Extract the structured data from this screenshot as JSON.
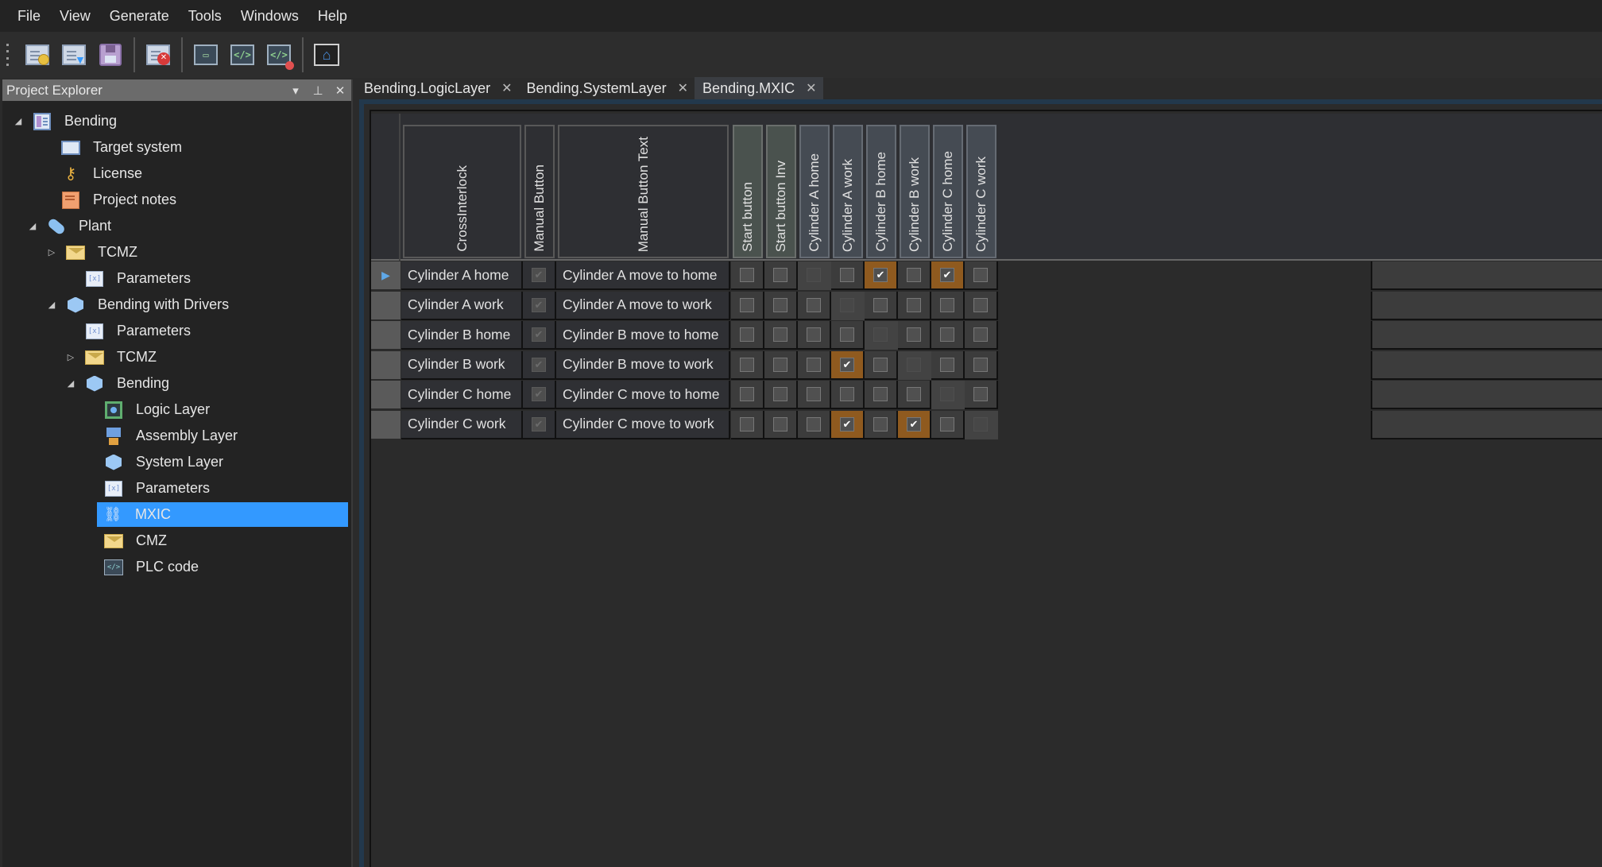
{
  "menu": [
    "File",
    "View",
    "Generate",
    "Tools",
    "Windows",
    "Help"
  ],
  "toolbar": {
    "buttons": [
      {
        "name": "new-project-icon"
      },
      {
        "name": "open-project-icon"
      },
      {
        "name": "save-icon"
      },
      {
        "name": "close-project-icon"
      },
      {
        "name": "generate-layout-icon"
      },
      {
        "name": "generate-code-icon"
      },
      {
        "name": "remove-code-icon"
      },
      {
        "name": "home-icon"
      }
    ]
  },
  "explorer": {
    "title": "Project Explorer",
    "items": [
      {
        "label": "Bending",
        "icon": "project-icon",
        "expander": "open"
      },
      {
        "label": "Target system",
        "icon": "target-system-icon"
      },
      {
        "label": "License",
        "icon": "key-icon"
      },
      {
        "label": "Project notes",
        "icon": "notes-icon"
      },
      {
        "label": "Plant",
        "icon": "plant-icon",
        "expander": "open"
      },
      {
        "label": "TCMZ",
        "icon": "folder-icon",
        "expander": "closed"
      },
      {
        "label": "Parameters",
        "icon": "parameters-icon"
      },
      {
        "label": "Bending with Drivers",
        "icon": "cube-icon",
        "expander": "open"
      },
      {
        "label": "Parameters",
        "icon": "parameters-icon"
      },
      {
        "label": "TCMZ",
        "icon": "folder-icon",
        "expander": "closed"
      },
      {
        "label": "Bending",
        "icon": "cube-icon",
        "expander": "open"
      },
      {
        "label": "Logic Layer",
        "icon": "logic-layer-icon"
      },
      {
        "label": "Assembly Layer",
        "icon": "assembly-layer-icon"
      },
      {
        "label": "System Layer",
        "icon": "cube-icon"
      },
      {
        "label": "Parameters",
        "icon": "parameters-icon"
      },
      {
        "label": "MXIC",
        "icon": "mxic-icon",
        "selected": true
      },
      {
        "label": "CMZ",
        "icon": "folder-icon"
      },
      {
        "label": "PLC code",
        "icon": "code-icon"
      }
    ]
  },
  "tabs": [
    {
      "label": "Bending.LogicLayer",
      "active": false
    },
    {
      "label": "Bending.SystemLayer",
      "active": false
    },
    {
      "label": "Bending.MXIC",
      "active": true
    }
  ],
  "grid": {
    "text_columns": [
      "CrossInterlock",
      "Manual Button",
      "Manual Button Text"
    ],
    "check_columns": [
      {
        "label": "Start button",
        "group": "start"
      },
      {
        "label": "Start button Inv",
        "group": "start"
      },
      {
        "label": "Cylinder A home",
        "group": "cyl"
      },
      {
        "label": "Cylinder A work",
        "group": "cyl"
      },
      {
        "label": "Cylinder B home",
        "group": "cyl"
      },
      {
        "label": "Cylinder B work",
        "group": "cyl"
      },
      {
        "label": "Cylinder C home",
        "group": "cyl"
      },
      {
        "label": "Cylinder C work",
        "group": "cyl"
      }
    ],
    "rows": [
      {
        "name": "Cylinder A home",
        "manual": true,
        "text": "Cylinder A move to home",
        "checks": [
          false,
          false,
          null,
          false,
          true,
          false,
          true,
          false
        ],
        "current": true
      },
      {
        "name": "Cylinder A work",
        "manual": true,
        "text": "Cylinder A move to work",
        "checks": [
          false,
          false,
          false,
          null,
          false,
          false,
          false,
          false
        ]
      },
      {
        "name": "Cylinder B home",
        "manual": true,
        "text": "Cylinder B move to home",
        "checks": [
          false,
          false,
          false,
          false,
          null,
          false,
          false,
          false
        ]
      },
      {
        "name": "Cylinder B work",
        "manual": true,
        "text": "Cylinder B move to work",
        "checks": [
          false,
          false,
          false,
          true,
          false,
          null,
          false,
          false
        ]
      },
      {
        "name": "Cylinder C home",
        "manual": true,
        "text": "Cylinder C move to home",
        "checks": [
          false,
          false,
          false,
          false,
          false,
          false,
          null,
          false
        ]
      },
      {
        "name": "Cylinder C work",
        "manual": true,
        "text": "Cylinder C move to work",
        "checks": [
          false,
          false,
          false,
          true,
          false,
          true,
          false,
          null
        ]
      }
    ],
    "current_row_marker": "▶",
    "check_mark": "✔"
  },
  "colors": {
    "selection": "#3399ff",
    "checked_cell": "#8f5a1f",
    "start_header": "#4a524e",
    "cylinder_header": "#454b53"
  }
}
